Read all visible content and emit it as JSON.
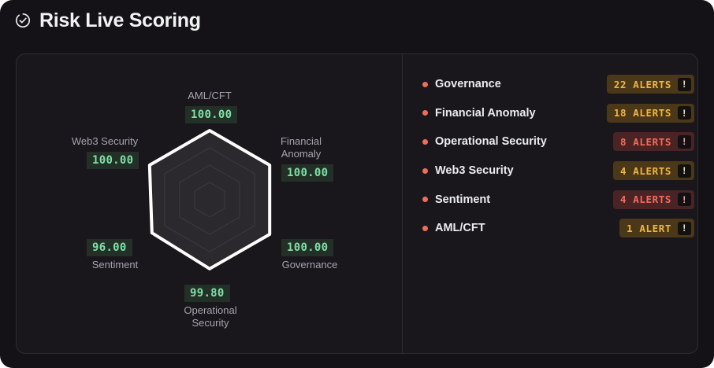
{
  "header": {
    "title": "Risk Live Scoring",
    "icon": "check-circle-icon"
  },
  "radar": {
    "max": 100,
    "axes": [
      {
        "label": "AML/CFT",
        "score": "100.00",
        "value": 100
      },
      {
        "label": "Financial\nAnomaly",
        "score": "100.00",
        "value": 100
      },
      {
        "label": "Governance",
        "score": "100.00",
        "value": 100
      },
      {
        "label": "Operational\nSecurity",
        "score": "99.80",
        "value": 99.8
      },
      {
        "label": "Sentiment",
        "score": "96.00",
        "value": 96
      },
      {
        "label": "Web3 Security",
        "score": "100.00",
        "value": 100
      }
    ],
    "rings": 4,
    "colors": {
      "fill": "#2b292e",
      "stroke": "#ffffff",
      "grid": "#3a383e"
    }
  },
  "alerts": [
    {
      "name": "Governance",
      "badge": "22 ALERTS",
      "tone": "amber",
      "icon": "exclamation-icon",
      "mark": "!"
    },
    {
      "name": "Financial Anomaly",
      "badge": "18 ALERTS",
      "tone": "amber",
      "icon": "exclamation-icon",
      "mark": "!"
    },
    {
      "name": "Operational Security",
      "badge": "8 ALERTS",
      "tone": "red",
      "icon": "exclamation-icon",
      "mark": "!"
    },
    {
      "name": "Web3 Security",
      "badge": "4 ALERTS",
      "tone": "amber",
      "icon": "exclamation-icon",
      "mark": "!"
    },
    {
      "name": "Sentiment",
      "badge": "4 ALERTS",
      "tone": "red",
      "icon": "exclamation-icon",
      "mark": "!"
    },
    {
      "name": "AML/CFT",
      "badge": "1 ALERT",
      "tone": "amber",
      "icon": "exclamation-icon",
      "mark": "!"
    }
  ],
  "colors": {
    "amber": "#f1b546",
    "red": "#f06d5c",
    "score_text": "#7fe0a6",
    "background": "#141216"
  }
}
